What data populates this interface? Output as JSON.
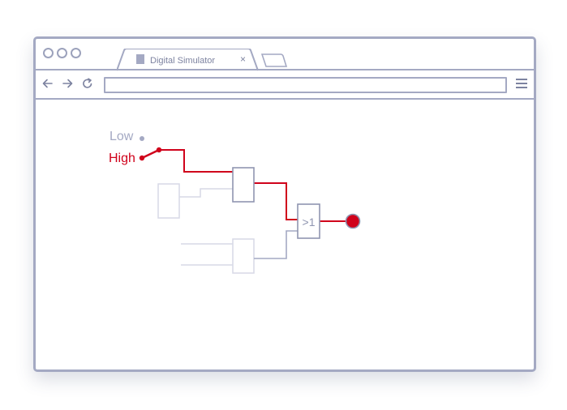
{
  "tab": {
    "title": "Digital Simulator",
    "close": "×"
  },
  "toolbar": {
    "url": ""
  },
  "circuit": {
    "switch_low_label": "Low",
    "switch_high_label": "High",
    "switch_state": "High",
    "or_gate_label": ">1",
    "output_state": "High"
  },
  "colors": {
    "frame": "#a4a9c3",
    "active_signal": "#d0021b",
    "inactive_wire": "#a4a9c3",
    "faded": "#d7d9e6"
  }
}
